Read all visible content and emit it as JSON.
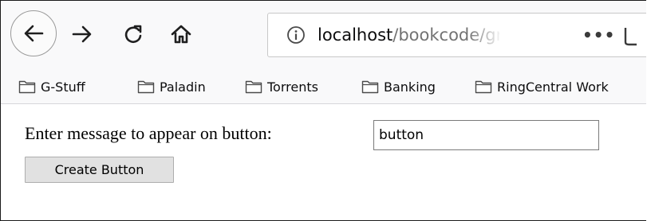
{
  "browser": {
    "url": {
      "host": "localhost",
      "path": "/bookcode/gra"
    },
    "more_actions": "•••",
    "icons": {
      "back": "back-arrow-icon",
      "forward": "forward-arrow-icon",
      "reload": "reload-icon",
      "home": "home-icon",
      "info": "info-icon",
      "more": "more-dots-icon",
      "pocket": "pocket-icon"
    },
    "bookmarks": [
      {
        "label": "G-Stuff",
        "icon": "folder-icon"
      },
      {
        "label": "Paladin",
        "icon": "folder-icon"
      },
      {
        "label": "Torrents",
        "icon": "folder-icon"
      },
      {
        "label": "Banking",
        "icon": "folder-icon"
      },
      {
        "label": "RingCentral Work",
        "icon": "folder-icon"
      }
    ]
  },
  "page": {
    "prompt_label": "Enter message to appear on button:",
    "message_input_value": "button",
    "create_button_label": "Create Button"
  }
}
